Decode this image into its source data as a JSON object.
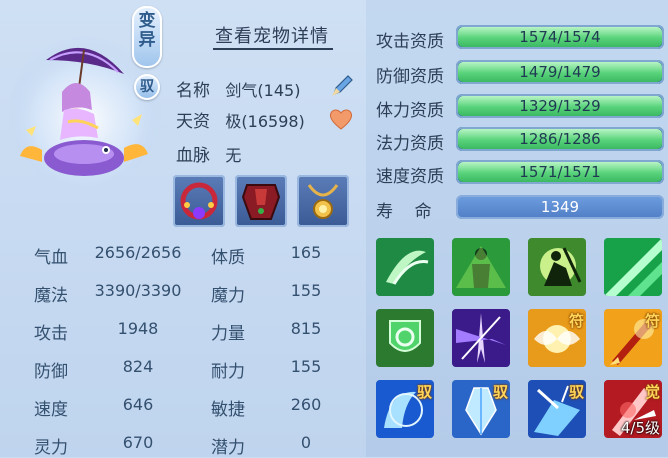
{
  "header": {
    "badge_variant": "变\n异",
    "badge_tame": "驭",
    "detail_link": "查看宠物详情"
  },
  "pet": {
    "name_label": "名称",
    "name_value": "剑气(145)",
    "talent_label": "天资",
    "talent_value": "极(16598)",
    "blood_label": "血脉",
    "blood_value": "无"
  },
  "equipment": [
    {
      "icon": "crimson-necklace-icon"
    },
    {
      "icon": "red-armor-icon"
    },
    {
      "icon": "gold-amulet-icon"
    }
  ],
  "stats": [
    {
      "label": "气血",
      "value": "2656/2656",
      "label2": "体质",
      "value2": "165"
    },
    {
      "label": "魔法",
      "value": "3390/3390",
      "label2": "魔力",
      "value2": "155"
    },
    {
      "label": "攻击",
      "value": "1948",
      "label2": "力量",
      "value2": "815"
    },
    {
      "label": "防御",
      "value": "824",
      "label2": "耐力",
      "value2": "155"
    },
    {
      "label": "速度",
      "value": "646",
      "label2": "敏捷",
      "value2": "260"
    },
    {
      "label": "灵力",
      "value": "670",
      "label2": "潜力",
      "value2": "0"
    }
  ],
  "aptitudes": [
    {
      "label": "攻击资质",
      "value": "1574/1574",
      "fill": 1.0
    },
    {
      "label": "防御资质",
      "value": "1479/1479",
      "fill": 1.0
    },
    {
      "label": "体力资质",
      "value": "1329/1329",
      "fill": 1.0
    },
    {
      "label": "法力资质",
      "value": "1286/1286",
      "fill": 1.0
    },
    {
      "label": "速度资质",
      "value": "1571/1571",
      "fill": 1.0
    }
  ],
  "lifespan": {
    "label": "寿    命",
    "value": "1349"
  },
  "skills": [
    {
      "icon": "wing-skill-icon",
      "tag": ""
    },
    {
      "icon": "green-figure-skill-icon",
      "tag": ""
    },
    {
      "icon": "warrior-skill-icon",
      "tag": ""
    },
    {
      "icon": "green-slash-skill-icon",
      "tag": ""
    },
    {
      "icon": "shield-skill-icon",
      "tag": ""
    },
    {
      "icon": "purple-burst-skill-icon",
      "tag": ""
    },
    {
      "icon": "golden-wings-skill-icon",
      "tag": "符"
    },
    {
      "icon": "flame-sword-skill-icon",
      "tag": "符"
    },
    {
      "icon": "blue-crystal-skill-icon",
      "tag": "驭"
    },
    {
      "icon": "ice-shard-skill-icon",
      "tag": "驭"
    },
    {
      "icon": "blue-shatter-skill-icon",
      "tag": "驭"
    },
    {
      "icon": "red-blade-skill-icon",
      "tag": "觉",
      "level": "4/5级"
    }
  ],
  "colors": {
    "bar_fill": "#59d37b",
    "bar_bg": "#2f6ea3",
    "life_bar": "#5a8ad0",
    "text": "#2d3f57"
  }
}
